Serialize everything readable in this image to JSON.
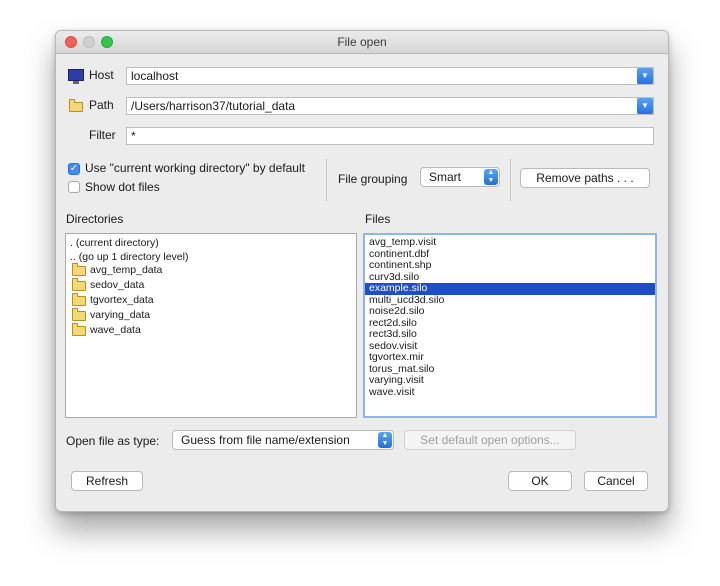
{
  "window": {
    "title": "File open"
  },
  "host": {
    "label": "Host",
    "value": "localhost"
  },
  "path": {
    "label": "Path",
    "value": "/Users/harrison37/tutorial_data"
  },
  "filter": {
    "label": "Filter",
    "value": "*"
  },
  "options": {
    "use_cwd_label": "Use \"current working directory\" by default",
    "use_cwd_checked": true,
    "show_dot_label": "Show dot files",
    "show_dot_checked": false,
    "grouping_label": "File grouping",
    "grouping_value": "Smart",
    "remove_paths_label": "Remove paths . . ."
  },
  "directories": {
    "header": "Directories",
    "special": [
      ". (current directory)",
      ".. (go up 1 directory level)"
    ],
    "folders": [
      "avg_temp_data",
      "sedov_data",
      "tgvortex_data",
      "varying_data",
      "wave_data"
    ]
  },
  "files": {
    "header": "Files",
    "items": [
      "avg_temp.visit",
      "continent.dbf",
      "continent.shp",
      "curv3d.silo",
      "example.silo",
      "multi_ucd3d.silo",
      "noise2d.silo",
      "rect2d.silo",
      "rect3d.silo",
      "sedov.visit",
      "tgvortex.mir",
      "torus_mat.silo",
      "varying.visit",
      "wave.visit"
    ],
    "selected_index": 4
  },
  "open_type": {
    "label": "Open file as type:",
    "value": "Guess from file name/extension",
    "default_options_label": "Set default open options..."
  },
  "buttons": {
    "refresh": "Refresh",
    "ok": "OK",
    "cancel": "Cancel"
  },
  "colors": {
    "accent": "#1f6fe0",
    "selection": "#1d4fc3",
    "close": "#fc5f57",
    "maximize": "#34c84a"
  }
}
